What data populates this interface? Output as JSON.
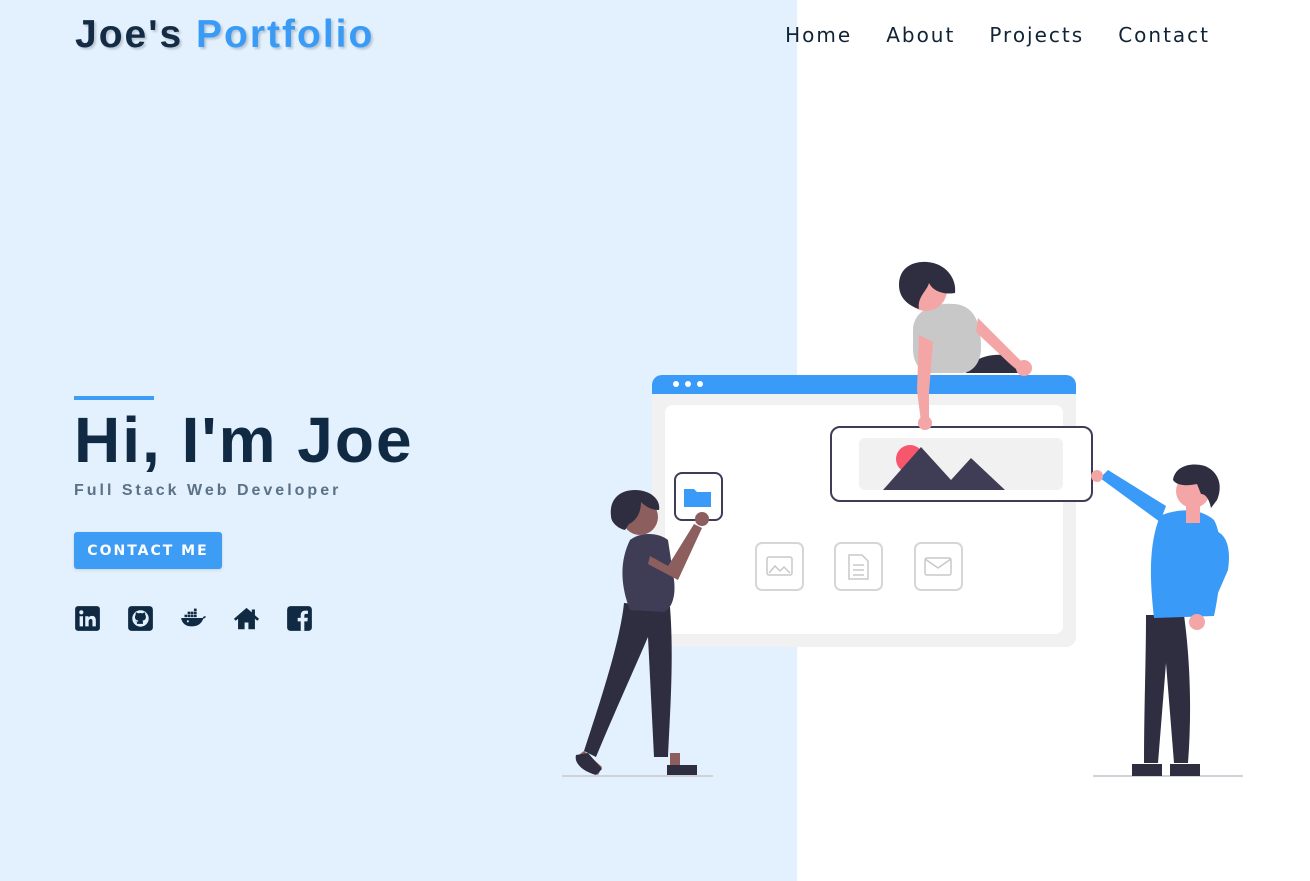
{
  "header": {
    "logo_part1": "Joe's",
    "logo_part2": "Portfolio"
  },
  "nav": {
    "items": [
      "Home",
      "About",
      "Projects",
      "Contact"
    ]
  },
  "hero": {
    "title": "Hi, I'm Joe",
    "subtitle": "Full Stack Web Developer",
    "cta_label": "CONTACT ME"
  },
  "socials": [
    "linkedin-icon",
    "github-icon",
    "docker-icon",
    "home-icon",
    "facebook-icon"
  ],
  "colors": {
    "accent": "#3d9df5",
    "dark": "#102a43",
    "left_background": "#e3f1fe"
  }
}
